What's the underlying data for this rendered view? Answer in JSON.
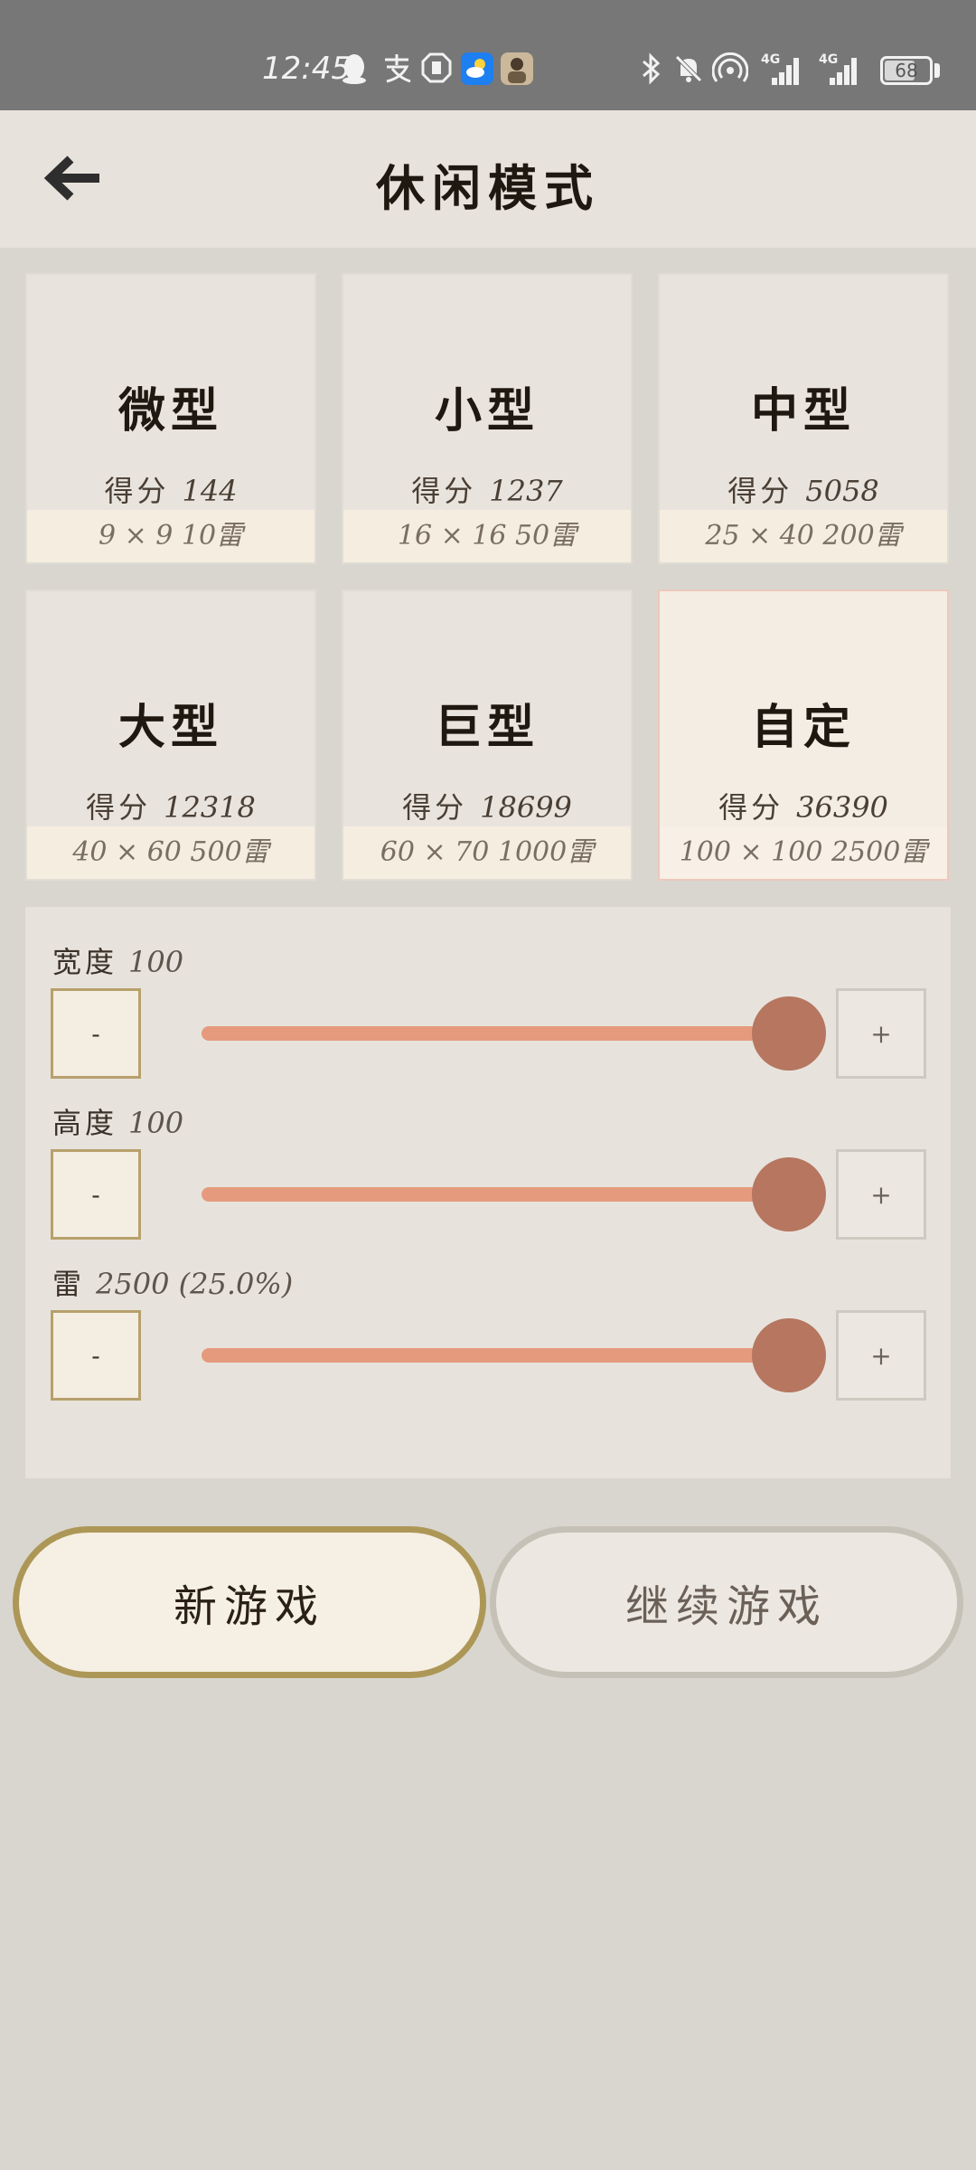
{
  "status_bar": {
    "time": "12:45",
    "battery": "68",
    "network_1": "4G",
    "network_2": "4G"
  },
  "header": {
    "title": "休闲模式"
  },
  "presets": [
    {
      "name": "微型",
      "score_label": "得分",
      "score": "144",
      "spec": "9 × 9   10雷"
    },
    {
      "name": "小型",
      "score_label": "得分",
      "score": "1237",
      "spec": "16 × 16   50雷"
    },
    {
      "name": "中型",
      "score_label": "得分",
      "score": "5058",
      "spec": "25 × 40   200雷"
    },
    {
      "name": "大型",
      "score_label": "得分",
      "score": "12318",
      "spec": "40 × 60   500雷"
    },
    {
      "name": "巨型",
      "score_label": "得分",
      "score": "18699",
      "spec": "60 × 70   1000雷"
    },
    {
      "name": "自定",
      "score_label": "得分",
      "score": "36390",
      "spec": "100 × 100   2500雷"
    }
  ],
  "custom": {
    "width": {
      "label": "宽度",
      "value": "100",
      "level": 1.0
    },
    "height": {
      "label": "高度",
      "value": "100",
      "level": 1.0
    },
    "mines": {
      "label": "雷",
      "value": "2500 (25.0%)",
      "level": 1.0
    },
    "minus": "-",
    "plus": "+"
  },
  "actions": {
    "new_game": "新游戏",
    "continue_game": "继续游戏"
  },
  "colors": {
    "accent": "#e69a7d",
    "thumb": "#b67660",
    "selected_border": "#ecc8ba",
    "new_game_border": "#ad9757"
  }
}
